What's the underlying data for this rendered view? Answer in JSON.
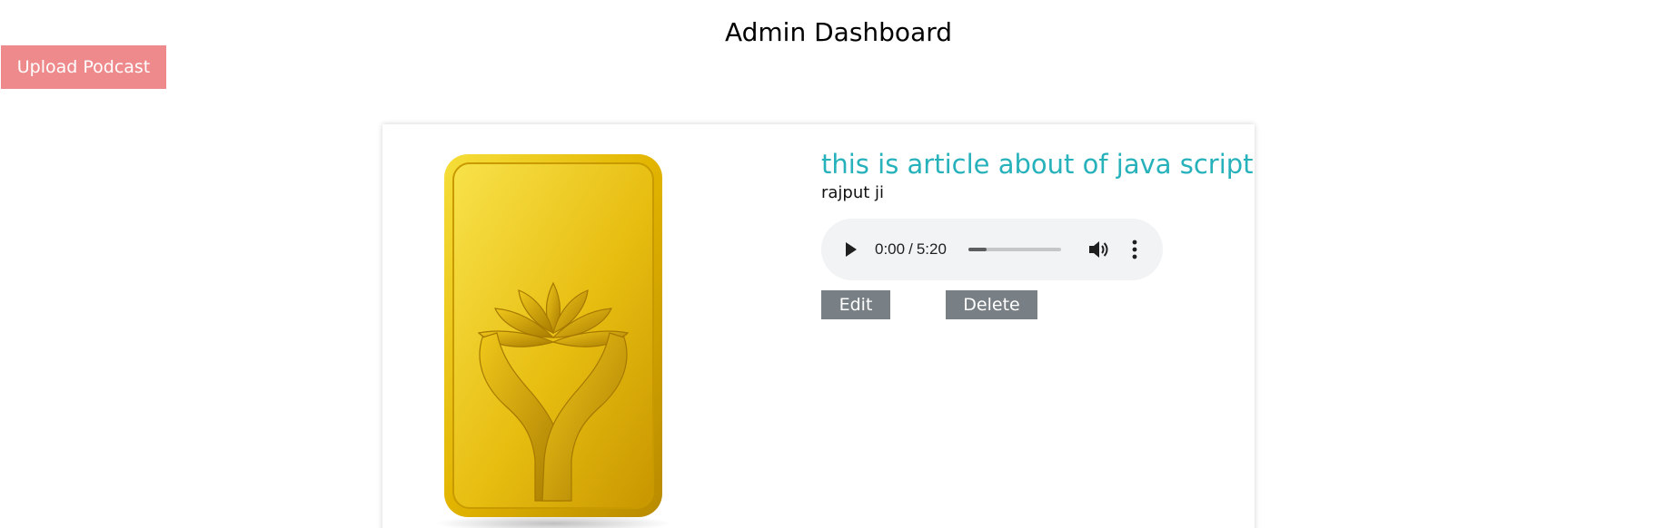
{
  "header": {
    "title": "Admin Dashboard"
  },
  "toolbar": {
    "upload_label": "Upload Podcast",
    "upload_color": "#ee8a8c"
  },
  "podcast": {
    "thumbnail_alt": "gold bar with lotus and hands",
    "title": "this is article about of java script",
    "title_color": "#27b2bb",
    "author": "rajput ji",
    "player": {
      "current_time": "0:00",
      "separator": "/",
      "duration": "5:20",
      "progress_fraction": 0.2,
      "play_icon": "play-icon",
      "volume_icon": "volume-icon",
      "menu_icon": "more-vertical-icon"
    },
    "actions": {
      "edit_label": "Edit",
      "delete_label": "Delete",
      "button_color": "#787f85"
    }
  }
}
